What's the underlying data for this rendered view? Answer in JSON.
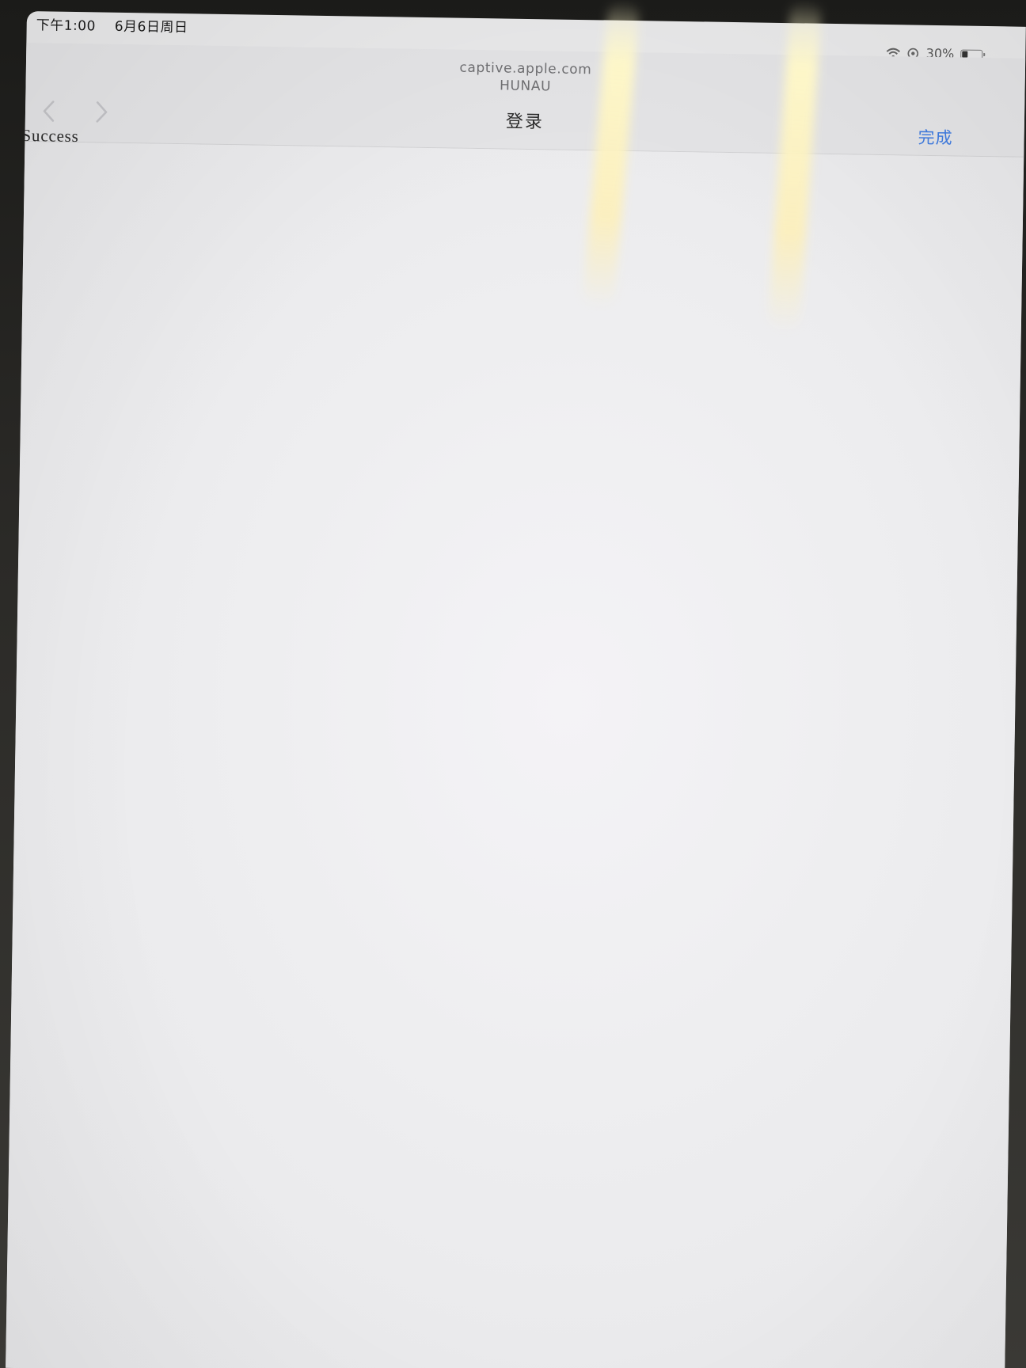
{
  "status_bar": {
    "time": "下午1:00",
    "date": "6月6日周日",
    "battery_percent": "30%",
    "battery_level": 0.3
  },
  "nav": {
    "url_host": "captive.apple.com",
    "network_name": "HUNAU",
    "title": "登录",
    "done_label": "完成",
    "icons": {
      "back": "chevron-left-icon",
      "forward": "chevron-right-icon"
    }
  },
  "content": {
    "text": "Success"
  },
  "colors": {
    "accent": "#3f7be0"
  }
}
